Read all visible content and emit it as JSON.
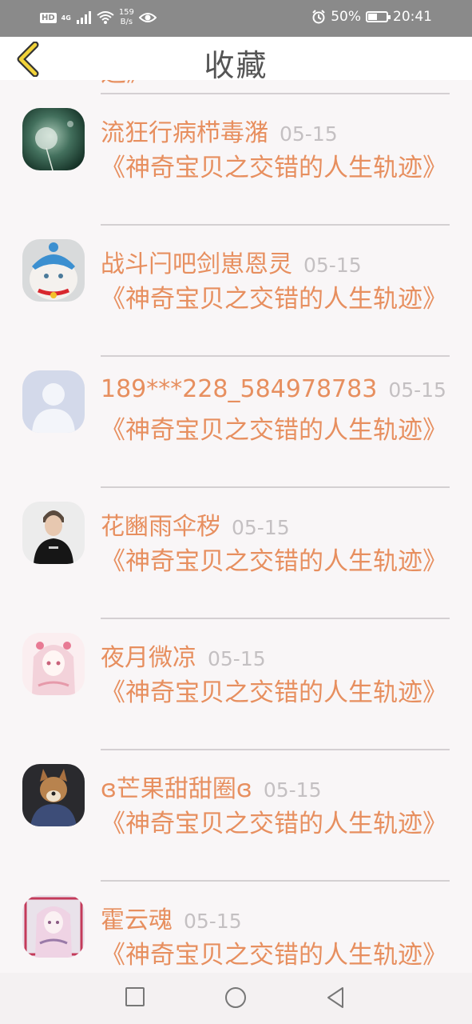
{
  "status_bar": {
    "left_badges": [
      "HD",
      "4G"
    ],
    "net_speed_value": "159",
    "net_speed_unit": "B/s",
    "battery": "50%",
    "time": "20:41",
    "icons": [
      "signal-icon",
      "wifi-icon",
      "eye-icon",
      "alarm-icon",
      "battery-icon"
    ]
  },
  "header": {
    "title": "收藏",
    "back_icon": "chevron-left-icon"
  },
  "list": {
    "cut_top_text": "迹》",
    "items": [
      {
        "name": "流狂行病栉毒潴",
        "date": "05-15",
        "work": "《神奇宝贝之交错的人生轨迹》",
        "avatar": "dandelion-photo"
      },
      {
        "name": "战斗闩吧剑崽恩灵",
        "date": "05-15",
        "work": "《神奇宝贝之交错的人生轨迹》",
        "avatar": "cat-photo"
      },
      {
        "name": "189***228_584978783",
        "date": "05-15",
        "work": "《神奇宝贝之交错的人生轨迹》",
        "avatar": "default-user"
      },
      {
        "name": "花豳雨伞秽",
        "date": "05-15",
        "work": "《神奇宝贝之交错的人生轨迹》",
        "avatar": "man-photo"
      },
      {
        "name": "夜月微凉",
        "date": "05-15",
        "work": "《神奇宝贝之交错的人生轨迹》",
        "avatar": "anime-girl"
      },
      {
        "name": "ɞ芒果甜甜圈ɞ",
        "date": "05-15",
        "work": "《神奇宝贝之交错的人生轨迹》",
        "avatar": "dog-photo"
      },
      {
        "name": "霍云魂",
        "date": "05-15",
        "work": "《神奇宝贝之交错的人生轨迹》",
        "avatar": "anime-girl-2"
      }
    ]
  },
  "nav_bar": {
    "buttons": [
      "recent-apps-icon",
      "home-icon",
      "back-icon"
    ]
  },
  "colors": {
    "accent": "#e78f5f",
    "date": "#c4c0c2",
    "background": "#f9f6f7",
    "status_bar": "#8a8a8a",
    "back_chevron": "#f2d33a"
  }
}
